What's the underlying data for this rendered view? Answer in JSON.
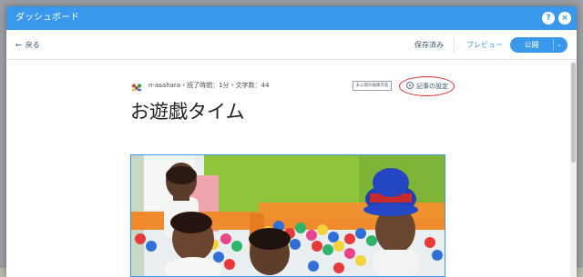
{
  "window": {
    "title": "ダッシュボード",
    "help_label": "?",
    "close_label": "×"
  },
  "toolbar": {
    "back_arrow": "←",
    "back_label": "戻る",
    "saved_status": "保存済み",
    "preview_label": "プレビュー",
    "publish_label": "公開",
    "publish_caret": "⌄"
  },
  "post": {
    "author": "n-asahara",
    "read_time": "読了時間：1分",
    "char_count": "文字数：44",
    "meta_separator": "・",
    "draft_button_label": "未公開の編集内容",
    "settings_label": "記事の設定",
    "settings_icon": "gear-icon",
    "title": "お遊戯タイム",
    "cover_image": "children-in-ball-pit-photo"
  },
  "colors": {
    "accent": "#3899ec",
    "highlight_ellipse": "#e3262c"
  }
}
